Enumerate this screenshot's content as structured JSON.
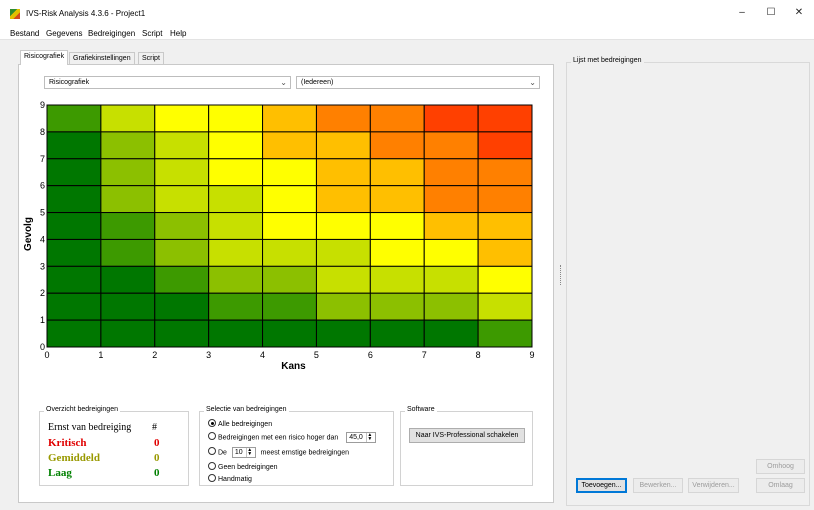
{
  "window": {
    "title": "IVS-Risk Analysis 4.3.6 - Project1",
    "minimize_glyph": "–",
    "maximize_glyph": "☐",
    "close_glyph": "✕"
  },
  "menu": [
    "Bestand",
    "Gegevens",
    "Bedreigingen",
    "Script",
    "Help"
  ],
  "tabs": [
    "Risicografiek",
    "Grafiekinstellingen",
    "Script"
  ],
  "active_tab": "Risicografiek",
  "chart_select": "Risicografiek",
  "filter_select": "(Iedereen)",
  "chart_data": {
    "type": "heatmap",
    "xlabel": "Kans",
    "ylabel": "Gevolg",
    "xlim": [
      0,
      9
    ],
    "ylim": [
      0,
      9
    ],
    "x_ticks": [
      "0",
      "1",
      "2",
      "3",
      "4",
      "5",
      "6",
      "7",
      "8",
      "9"
    ],
    "y_ticks": [
      "0",
      "1",
      "2",
      "3",
      "4",
      "5",
      "6",
      "7",
      "8",
      "9"
    ],
    "cell_colors_top_to_bottom": [
      [
        "#3d9a00",
        "#c7e000",
        "#ffff00",
        "#ffff00",
        "#ffbf00",
        "#ff8000",
        "#ff8000",
        "#ff4000",
        "#ff4000"
      ],
      [
        "#007700",
        "#8cc000",
        "#c7e000",
        "#ffff00",
        "#ffbf00",
        "#ffbf00",
        "#ff8000",
        "#ff8000",
        "#ff4000"
      ],
      [
        "#007700",
        "#8cc000",
        "#c7e000",
        "#ffff00",
        "#ffff00",
        "#ffbf00",
        "#ffbf00",
        "#ff8000",
        "#ff8000"
      ],
      [
        "#007700",
        "#8cc000",
        "#c7e000",
        "#c7e000",
        "#ffff00",
        "#ffbf00",
        "#ffbf00",
        "#ff8000",
        "#ff8000"
      ],
      [
        "#007700",
        "#3d9a00",
        "#8cc000",
        "#c7e000",
        "#ffff00",
        "#ffff00",
        "#ffff00",
        "#ffbf00",
        "#ffbf00"
      ],
      [
        "#007700",
        "#3d9a00",
        "#8cc000",
        "#c7e000",
        "#c7e000",
        "#c7e000",
        "#ffff00",
        "#ffff00",
        "#ffbf00"
      ],
      [
        "#007700",
        "#007700",
        "#3d9a00",
        "#8cc000",
        "#8cc000",
        "#c7e000",
        "#c7e000",
        "#c7e000",
        "#ffff00"
      ],
      [
        "#007700",
        "#007700",
        "#007700",
        "#3d9a00",
        "#3d9a00",
        "#8cc000",
        "#8cc000",
        "#8cc000",
        "#c7e000"
      ],
      [
        "#007700",
        "#007700",
        "#007700",
        "#007700",
        "#007700",
        "#007700",
        "#007700",
        "#007700",
        "#3d9a00"
      ]
    ]
  },
  "overview": {
    "title": "Overzicht bedreigingen",
    "header_label": "Ernst van bedreiging",
    "header_count": "#",
    "rows": [
      {
        "label": "Kritisch",
        "count": "0",
        "color": "#e00000"
      },
      {
        "label": "Gemiddeld",
        "count": "0",
        "color": "#999900"
      },
      {
        "label": "Laag",
        "count": "0",
        "color": "#008000"
      }
    ]
  },
  "selection": {
    "title": "Selectie van bedreigingen",
    "option_all": "Alle bedreigingen",
    "option_risk": "Bedreigingen met een risico hoger dan",
    "risk_value": "45,0",
    "option_top_prefix": "De",
    "top_value": "10",
    "option_top_suffix": "meest ernstige bedreigingen",
    "option_none": "Geen bedreigingen",
    "option_manual": "Handmatig"
  },
  "software": {
    "title": "Software",
    "button": "Naar IVS-Professional schakelen"
  },
  "threat_list": {
    "title": "Lijst met bedreigingen",
    "up": "Omhoog",
    "down": "Omlaag",
    "add": "Toevoegen...",
    "edit": "Bewerken...",
    "delete": "Verwijderen..."
  }
}
